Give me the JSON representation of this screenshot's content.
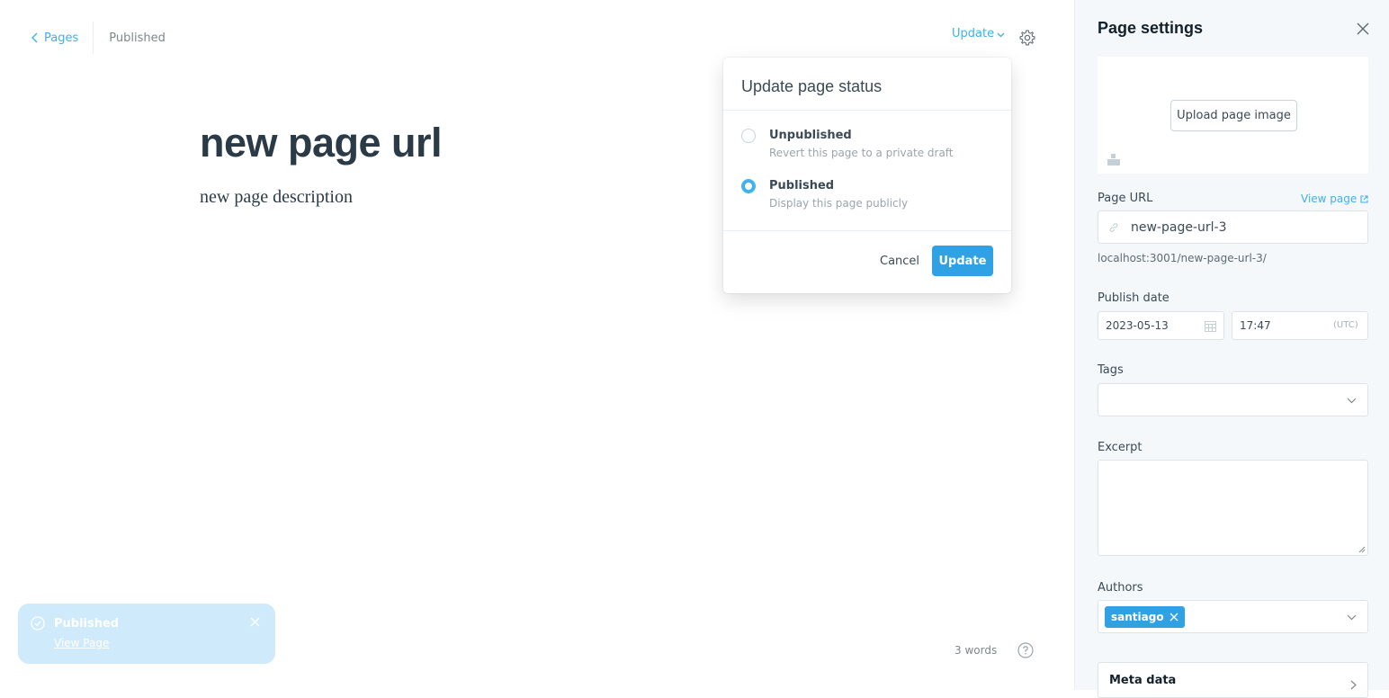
{
  "header": {
    "back_label": "Pages",
    "status_label": "Published",
    "update_menu_label": "Update"
  },
  "content": {
    "title": "new page url",
    "description": "new page description"
  },
  "status_popup": {
    "title": "Update page status",
    "options": [
      {
        "label": "Unpublished",
        "sublabel": "Revert this page to a private draft",
        "selected": false
      },
      {
        "label": "Published",
        "sublabel": "Display this page publicly",
        "selected": true
      }
    ],
    "cancel_label": "Cancel",
    "confirm_label": "Update"
  },
  "toast": {
    "title": "Published",
    "link": "View Page"
  },
  "footer": {
    "word_count": "3 words"
  },
  "settings": {
    "title": "Page settings",
    "upload_image_label": "Upload page image",
    "page_url_label": "Page URL",
    "view_page_label": "View page",
    "page_url_value": "new-page-url-3",
    "url_hint": "localhost:3001/new-page-url-3/",
    "publish_date_label": "Publish date",
    "date_value": "2023-05-13",
    "time_value": "17:47",
    "timezone": "(UTC)",
    "tags_label": "Tags",
    "excerpt_label": "Excerpt",
    "authors_label": "Authors",
    "authors": [
      "santiago"
    ],
    "meta_label": "Meta data"
  },
  "colors": {
    "accent": "#3eb0ef",
    "button": "#30a2e3",
    "toast_bg": "#cfeafb",
    "panel_bg": "#f4f8fb"
  }
}
